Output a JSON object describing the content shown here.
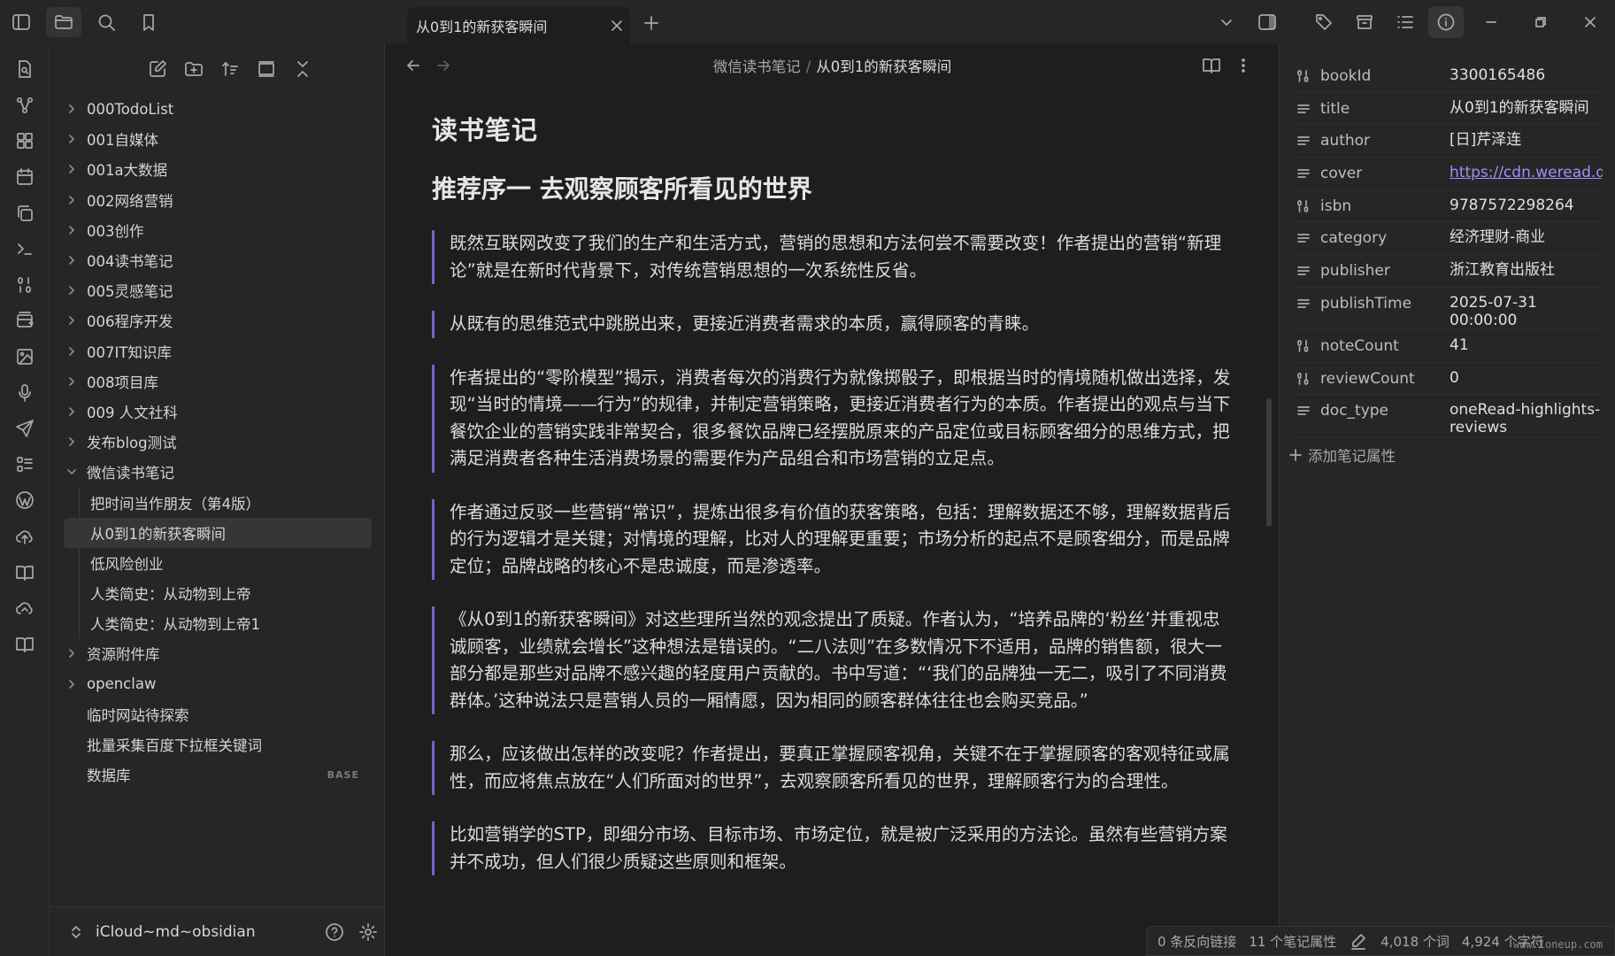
{
  "tab": {
    "title": "从0到1的新获客瞬间"
  },
  "breadcrumb": {
    "folder": "微信读书笔记",
    "separator": "/",
    "current": "从0到1的新获客瞬间"
  },
  "explorer": {
    "items": [
      {
        "label": "000TodoList",
        "type": "folder"
      },
      {
        "label": "001自媒体",
        "type": "folder"
      },
      {
        "label": "001a大数据",
        "type": "folder"
      },
      {
        "label": "002网络营销",
        "type": "folder"
      },
      {
        "label": "003创作",
        "type": "folder"
      },
      {
        "label": "004读书笔记",
        "type": "folder"
      },
      {
        "label": "005灵感笔记",
        "type": "folder"
      },
      {
        "label": "006程序开发",
        "type": "folder"
      },
      {
        "label": "007IT知识库",
        "type": "folder"
      },
      {
        "label": "008项目库",
        "type": "folder"
      },
      {
        "label": "009 人文社科",
        "type": "folder"
      },
      {
        "label": "发布blog测试",
        "type": "folder"
      },
      {
        "label": "微信读书笔记",
        "type": "folder-open"
      }
    ],
    "children": [
      {
        "label": "把时间当作朋友（第4版）"
      },
      {
        "label": "从0到1的新获客瞬间",
        "selected": true
      },
      {
        "label": "低风险创业"
      },
      {
        "label": "人类简史：从动物到上帝"
      },
      {
        "label": "人类简史：从动物到上帝1"
      }
    ],
    "after": [
      {
        "label": "资源附件库",
        "type": "folder"
      },
      {
        "label": "openclaw",
        "type": "folder"
      },
      {
        "label": "临时网站待探索",
        "type": "file"
      },
      {
        "label": "批量采集百度下拉框关键词",
        "type": "file"
      },
      {
        "label": "数据库",
        "type": "file",
        "badge": "BASE"
      }
    ],
    "vault_name": "iCloud~md~obsidian"
  },
  "note": {
    "h1": "读书笔记",
    "h2": "推荐序一 去观察顾客所看见的世界",
    "quotes": [
      "既然互联网改变了我们的生产和生活方式，营销的思想和方法何尝不需要改变！作者提出的营销“新理论”就是在新时代背景下，对传统营销思想的一次系统性反省。",
      "从既有的思维范式中跳脱出来，更接近消费者需求的本质，赢得顾客的青睐。",
      "作者提出的“零阶模型”揭示，消费者每次的消费行为就像掷骰子，即根据当时的情境随机做出选择，发现“当时的情境——行为”的规律，并制定营销策略，更接近消费者行为的本质。作者提出的观点与当下餐饮企业的营销实践非常契合，很多餐饮品牌已经摆脱原来的产品定位或目标顾客细分的思维方式，把满足消费者各种生活消费场景的需要作为产品组合和市场营销的立足点。",
      "作者通过反驳一些营销“常识”，提炼出很多有价值的获客策略，包括：理解数据还不够，理解数据背后的行为逻辑才是关键；对情境的理解，比对人的理解更重要；市场分析的起点不是顾客细分，而是品牌定位；品牌战略的核心不是忠诚度，而是渗透率。",
      "《从0到1的新获客瞬间》对这些理所当然的观念提出了质疑。作者认为，“培养品牌的‘粉丝’并重视忠诚顾客，业绩就会增长”这种想法是错误的。“二八法则”在多数情况下不适用，品牌的销售额，很大一部分都是那些对品牌不感兴趣的轻度用户贡献的。书中写道：“‘我们的品牌独一无二，吸引了不同消费群体。’这种说法只是营销人员的一厢情愿，因为相同的顾客群体往往也会购买竞品。”",
      "那么，应该做出怎样的改变呢？作者提出，要真正掌握顾客视角，关键不在于掌握顾客的客观特征或属性，而应将焦点放在“人们所面对的世界”，去观察顾客所看见的世界，理解顾客行为的合理性。",
      "比如营销学的STP，即细分市场、目标市场、市场定位，就是被广泛采用的方法论。虽然有些营销方案并不成功，但人们很少质疑这些原则和框架。"
    ]
  },
  "properties": [
    {
      "key": "bookId",
      "value": "3300165486",
      "icon": "number-icon"
    },
    {
      "key": "title",
      "value": "从0到1的新获客瞬间",
      "icon": "text-icon"
    },
    {
      "key": "author",
      "value": "[日]芹泽连",
      "icon": "text-icon"
    },
    {
      "key": "cover",
      "value": "https://cdn.weread.qq",
      "icon": "text-icon",
      "link": true
    },
    {
      "key": "isbn",
      "value": "9787572298264",
      "icon": "number-icon"
    },
    {
      "key": "category",
      "value": "经济理财-商业",
      "icon": "text-icon"
    },
    {
      "key": "publisher",
      "value": "浙江教育出版社",
      "icon": "text-icon"
    },
    {
      "key": "publishTime",
      "value": "2025-07-31 00:00:00",
      "icon": "text-icon",
      "wrap": true
    },
    {
      "key": "noteCount",
      "value": "41",
      "icon": "number-icon"
    },
    {
      "key": "reviewCount",
      "value": "0",
      "icon": "number-icon"
    },
    {
      "key": "doc_type",
      "value": "oneRead-highlights-reviews",
      "icon": "text-icon",
      "wrap": true
    }
  ],
  "add_property_label": "添加笔记属性",
  "status": {
    "backlinks": "0 条反向链接",
    "properties": "11 个笔记属性",
    "words": "4,018 个词",
    "chars": "4,924 个字符"
  },
  "watermark": "www.ioneup.com"
}
